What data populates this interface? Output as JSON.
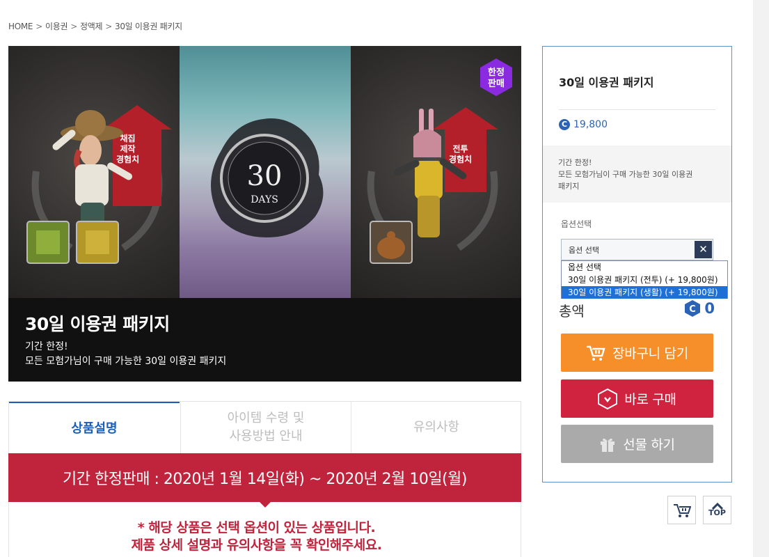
{
  "breadcrumb": {
    "items": [
      "HOME",
      "이용권",
      "정액제",
      "30일 이용권 패키지"
    ],
    "separator": ">"
  },
  "banner": {
    "title": "30일 이용권 패키지",
    "line1": "기간 한정!",
    "line2": "모든 모험가님이 구매 가능한 30일 이용권 패키지",
    "badge_line1": "한정",
    "badge_line2": "판매",
    "left_label": [
      "채집",
      "제작",
      "경험치"
    ],
    "right_label": [
      "전투",
      "경험치"
    ],
    "days_number": "30",
    "days_word": "DAYS"
  },
  "tabs": [
    {
      "label": "상품설명",
      "active": true
    },
    {
      "label": "아이템 수령 및\n사용방법 안내",
      "active": false
    },
    {
      "label": "유의사항",
      "active": false
    }
  ],
  "promo": {
    "text": "기간 한정판매 : 2020년 1월 14일(화) ~ 2020년 2월 10일(월)"
  },
  "notice": {
    "line1": "* 해당 상품은 선택 옵션이 있는 상품입니다.",
    "line2": "제품 상세 설명과 유의사항을 꼭 확인해주세요."
  },
  "side": {
    "product_title": "30일 이용권 패키지",
    "price": "19,800",
    "desc_line1": "기간 한정!",
    "desc_line2": "모든 모험가님이 구매 가능한 30일 이용권",
    "desc_line3": "패키지",
    "option_label": "옵션선택",
    "select_value": "옵션 선택",
    "options": [
      "옵션 선택",
      "30일 이용권 패키지 (전투) (+ 19,800원)",
      "30일 이용권 패키지 (생활) (+ 19,800원)"
    ],
    "selected_option_index": 2,
    "total_label": "총액",
    "total_value": "0",
    "cart_button": "장바구니 담기",
    "buy_button": "바로 구매",
    "gift_button": "선물 하기"
  },
  "floating": {
    "top_label": "TOP"
  },
  "colors": {
    "accent_blue": "#2c63b5",
    "tab_active": "#1c5fb8",
    "promo_red": "#c0243c",
    "cart_orange": "#f68f2a",
    "buy_red": "#d0233f",
    "gift_gray": "#aaaaaa",
    "badge_purple": "#8a2be2"
  },
  "currency_symbol": "C"
}
